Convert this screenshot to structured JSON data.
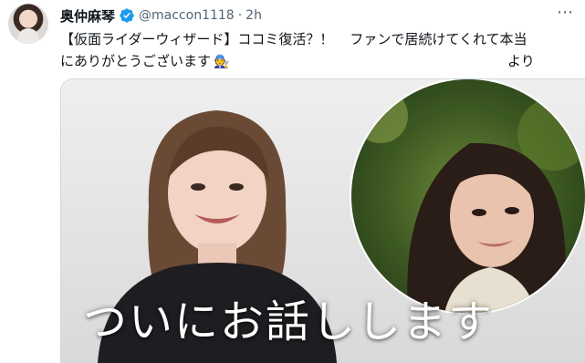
{
  "tweet": {
    "author": {
      "display_name": "奥仲麻琴",
      "handle": "@maccon1118",
      "verified": true
    },
    "separator": "·",
    "timestamp": "2h",
    "text_line1_part1": "【仮面ライダーウィザード】ココミ復活？！",
    "text_line1_part2": "ファンで居続けてくれて本当",
    "text_line2_part1": "にありがとうございます",
    "text_line2_part2": "より",
    "more_icon": "⋯"
  },
  "media": {
    "caption": "ついにお話しします"
  },
  "colors": {
    "text_primary": "#0f1419",
    "text_secondary": "#536471",
    "verified_blue": "#1d9bf0",
    "border": "#cfd9de"
  }
}
